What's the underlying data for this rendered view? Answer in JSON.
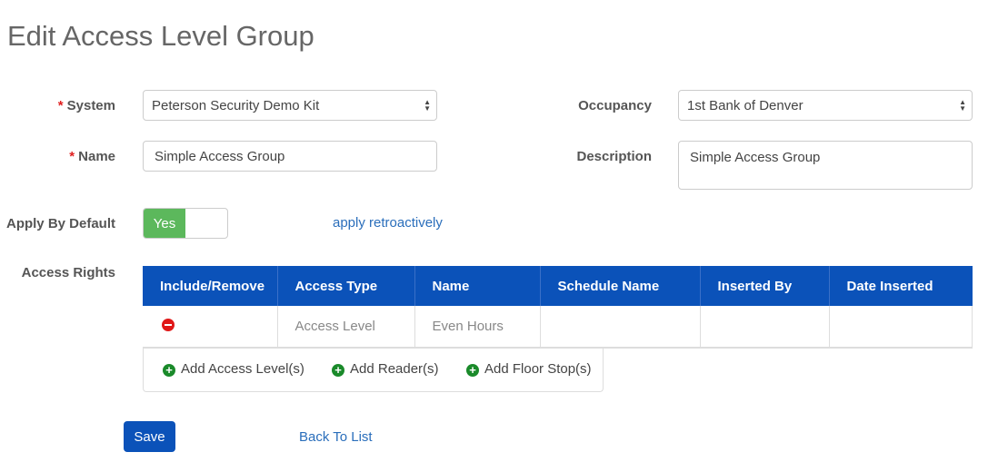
{
  "page_title": "Edit Access Level Group",
  "form": {
    "system_label": "System",
    "system_value": "Peterson Security Demo Kit",
    "occupancy_label": "Occupancy",
    "occupancy_value": "1st Bank of Denver",
    "name_label": "Name",
    "name_value": "Simple Access Group",
    "description_label": "Description",
    "description_value": "Simple Access Group",
    "apply_label": "Apply By Default",
    "apply_toggle": "Yes",
    "apply_retro": "apply retroactively",
    "access_rights_label": "Access Rights",
    "required_mark": "*"
  },
  "table": {
    "headers": [
      "Include/Remove",
      "Access Type",
      "Name",
      "Schedule Name",
      "Inserted By",
      "Date Inserted"
    ],
    "rows": [
      {
        "access_type": "Access Level",
        "name": "Even Hours",
        "schedule": "",
        "inserted_by": "",
        "date": ""
      }
    ]
  },
  "add_buttons": [
    "Add Access Level(s)",
    "Add Reader(s)",
    "Add Floor Stop(s)"
  ],
  "actions": {
    "save": "Save",
    "back": "Back To List"
  }
}
